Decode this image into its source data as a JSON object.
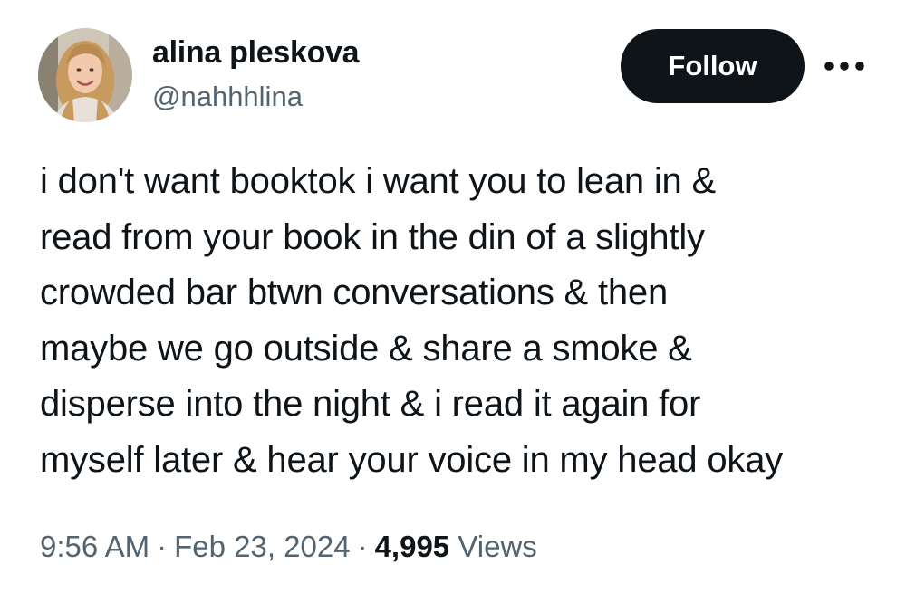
{
  "tweet": {
    "author": {
      "display_name": "alina pleskova",
      "handle": "@nahhhlina",
      "avatar_icon": "user-avatar"
    },
    "follow_label": "Follow",
    "more_icon": "more-horizontal-icon",
    "text": "i don't want booktok i want you to lean in &\nread from your book in the din of a slightly\ncrowded bar btwn conversations & then\nmaybe we go outside & share a smoke &\ndisperse into the night & i read it again for\nmyself later & hear your voice in my head okay",
    "time": "9:56 AM",
    "separator": "·",
    "date": "Feb 23, 2024",
    "views_count": "4,995",
    "views_label": "Views"
  },
  "colors": {
    "text_primary": "#0f1419",
    "text_secondary": "#536471",
    "follow_bg": "#0f1419",
    "follow_text": "#ffffff",
    "background": "#ffffff"
  }
}
